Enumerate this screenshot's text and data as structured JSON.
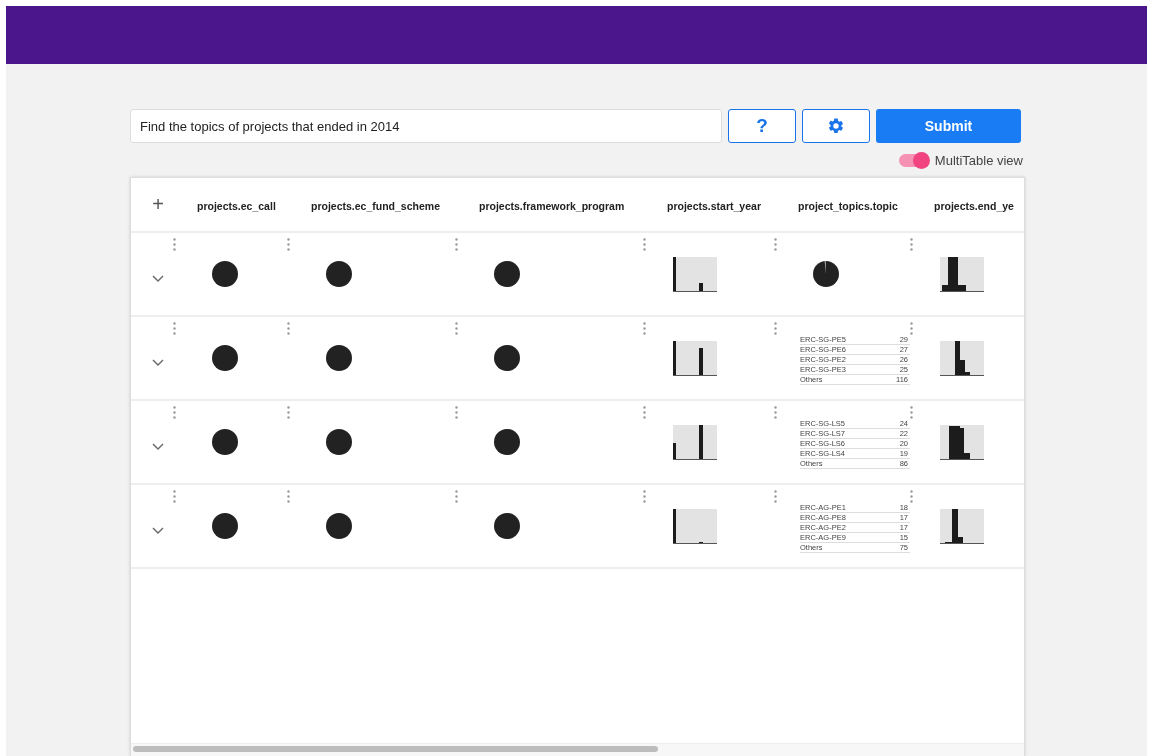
{
  "query": {
    "value": "Find the topics of projects that ended in 2014"
  },
  "buttons": [
    {
      "kind": "help",
      "label": "?"
    },
    {
      "kind": "settings"
    },
    {
      "kind": "submit",
      "label": "Submit"
    }
  ],
  "toggle": {
    "label": "MultiTable view",
    "on": true
  },
  "table": {
    "add_label": "+",
    "columns": [
      "projects.ec_call",
      "projects.ec_fund_scheme",
      "projects.framework_program",
      "projects.start_year",
      "project_topics.topic",
      "projects.end_ye"
    ],
    "rows": [
      {
        "expanded": false,
        "cells": [
          {
            "kind": "dot"
          },
          {
            "kind": "dot"
          },
          {
            "kind": "dot"
          },
          {
            "kind": "histogram"
          },
          {
            "kind": "pie"
          },
          {
            "kind": "histogram"
          }
        ]
      },
      {
        "expanded": false,
        "cells": [
          {
            "kind": "dot"
          },
          {
            "kind": "dot"
          },
          {
            "kind": "dot"
          },
          {
            "kind": "histogram"
          },
          {
            "kind": "top_list",
            "items": [
              {
                "label": "ERC-SG-PE5",
                "count": "29"
              },
              {
                "label": "ERC-SG-PE6",
                "count": "27"
              },
              {
                "label": "ERC-SG-PE2",
                "count": "26"
              },
              {
                "label": "ERC-SG-PE3",
                "count": "25"
              },
              {
                "label": "Others",
                "count": "116"
              }
            ]
          },
          {
            "kind": "histogram"
          }
        ]
      },
      {
        "expanded": false,
        "cells": [
          {
            "kind": "dot"
          },
          {
            "kind": "dot"
          },
          {
            "kind": "dot"
          },
          {
            "kind": "histogram"
          },
          {
            "kind": "top_list",
            "items": [
              {
                "label": "ERC-SG-LS5",
                "count": "24"
              },
              {
                "label": "ERC-SG-LS7",
                "count": "22"
              },
              {
                "label": "ERC-SG-LS6",
                "count": "20"
              },
              {
                "label": "ERC-SG-LS4",
                "count": "19"
              },
              {
                "label": "Others",
                "count": "86"
              }
            ]
          },
          {
            "kind": "histogram"
          }
        ]
      },
      {
        "expanded": false,
        "cells": [
          {
            "kind": "dot"
          },
          {
            "kind": "dot"
          },
          {
            "kind": "dot"
          },
          {
            "kind": "histogram"
          },
          {
            "kind": "top_list",
            "items": [
              {
                "label": "ERC-AG-PE1",
                "count": "18"
              },
              {
                "label": "ERC-AG-PE8",
                "count": "17"
              },
              {
                "label": "ERC-AG-PE2",
                "count": "17"
              },
              {
                "label": "ERC-AG-PE9",
                "count": "15"
              },
              {
                "label": "Others",
                "count": "75"
              }
            ]
          },
          {
            "kind": "histogram"
          }
        ]
      }
    ]
  }
}
